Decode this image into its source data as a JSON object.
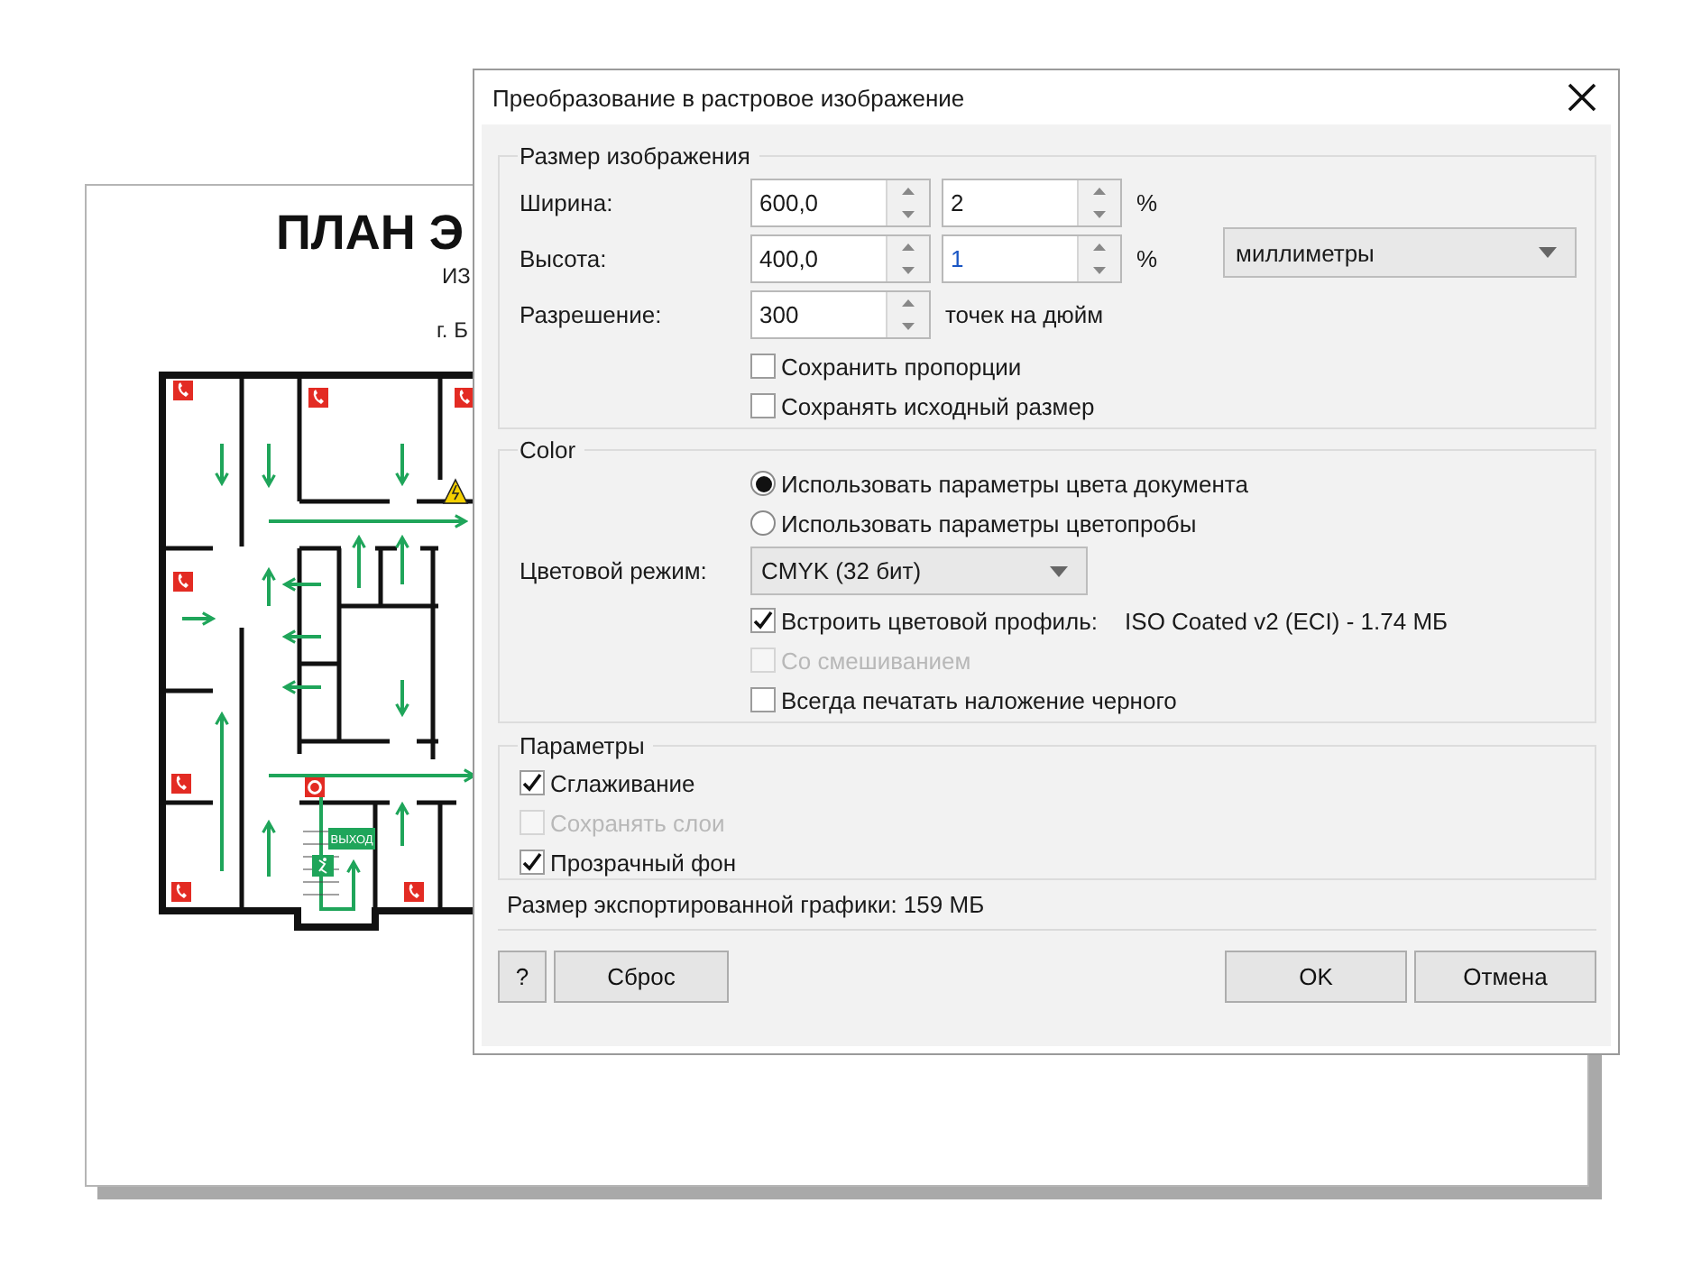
{
  "document": {
    "title": "ПЛАН Э",
    "lines": [
      "ИЗ",
      "г. Б"
    ],
    "exit_sign": "ВЫХОД"
  },
  "dialog": {
    "title": "Преобразование в растровое изображение",
    "size_group": {
      "legend": "Размер изображения",
      "rows": [
        {
          "label": "Ширина:",
          "value": "600,0",
          "percent_value": "2",
          "percent_focused": false,
          "unit": "%"
        },
        {
          "label": "Высота:",
          "value": "400,0",
          "percent_value": "1",
          "percent_focused": true,
          "unit": "%"
        }
      ],
      "resolution": {
        "label": "Разрешение:",
        "value": "300",
        "unit": "точек на дюйм"
      },
      "units": "миллиметры",
      "checkboxes": [
        {
          "label": "Сохранить пропорции",
          "checked": false,
          "disabled": false
        },
        {
          "label": "Сохранять исходный размер",
          "checked": false,
          "disabled": false
        }
      ]
    },
    "color_group": {
      "legend": "Color",
      "radios": [
        {
          "label": "Использовать параметры цвета документа",
          "selected": true
        },
        {
          "label": "Использовать параметры цветопробы",
          "selected": false
        }
      ],
      "mode_label": "Цветовой режим:",
      "mode_value": "CMYK (32 бит)",
      "checkboxes": [
        {
          "label": "Встроить цветовой профиль:",
          "detail": "ISO Coated v2 (ECI) - 1.74 МБ",
          "checked": true,
          "disabled": false
        },
        {
          "label": "Со смешиванием",
          "checked": false,
          "disabled": true
        },
        {
          "label": "Всегда печатать наложение черного",
          "checked": false,
          "disabled": false
        }
      ]
    },
    "params_group": {
      "legend": "Параметры",
      "checkboxes": [
        {
          "label": "Сглаживание",
          "checked": true,
          "disabled": false
        },
        {
          "label": "Сохранять слои",
          "checked": false,
          "disabled": true
        },
        {
          "label": "Прозрачный фон",
          "checked": true,
          "disabled": false
        }
      ]
    },
    "export_size": "Размер экспортированной графики: 159 МБ",
    "left_buttons": [
      "?",
      "Сброс"
    ],
    "right_buttons": [
      "OK",
      "Отмена"
    ]
  }
}
